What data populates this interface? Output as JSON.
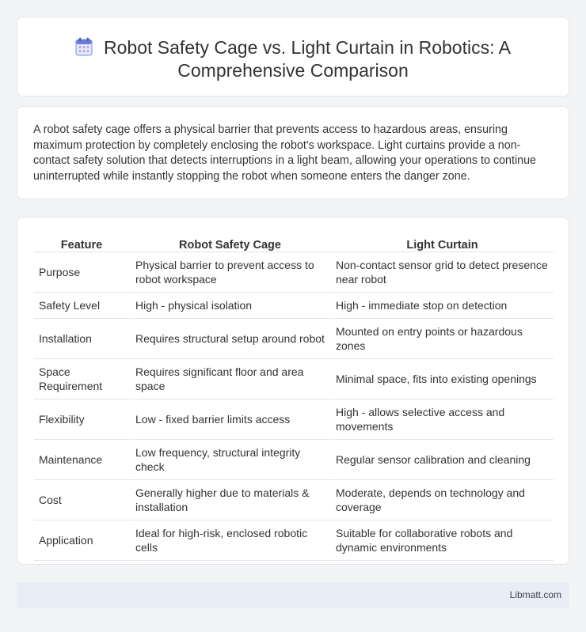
{
  "header": {
    "title": "Robot Safety Cage vs. Light Curtain in Robotics: A Comprehensive Comparison",
    "icon": "calendar-icon"
  },
  "intro": {
    "text": "A robot safety cage offers a physical barrier that prevents access to hazardous areas, ensuring maximum protection by completely enclosing the robot's workspace. Light curtains provide a non-contact safety solution that detects interruptions in a light beam, allowing your operations to continue uninterrupted while instantly stopping the robot when someone enters the danger zone."
  },
  "table": {
    "headers": [
      "Feature",
      "Robot Safety Cage",
      "Light Curtain"
    ],
    "rows": [
      [
        "Purpose",
        "Physical barrier to prevent access to robot workspace",
        "Non-contact sensor grid to detect presence near robot"
      ],
      [
        "Safety Level",
        "High - physical isolation",
        "High - immediate stop on detection"
      ],
      [
        "Installation",
        "Requires structural setup around robot",
        "Mounted on entry points or hazardous zones"
      ],
      [
        "Space Requirement",
        "Requires significant floor and area space",
        "Minimal space, fits into existing openings"
      ],
      [
        "Flexibility",
        "Low - fixed barrier limits access",
        "High - allows selective access and movements"
      ],
      [
        "Maintenance",
        "Low frequency, structural integrity check",
        "Regular sensor calibration and cleaning"
      ],
      [
        "Cost",
        "Generally higher due to materials & installation",
        "Moderate, depends on technology and coverage"
      ],
      [
        "Application",
        "Ideal for high-risk, enclosed robotic cells",
        "Suitable for collaborative robots and dynamic environments"
      ]
    ]
  },
  "footer": {
    "brand": "Libmatt.com"
  },
  "colors": {
    "background": "#f3f4f6",
    "card": "#ffffff",
    "footer": "#e8edf7",
    "icon_accent": "#6b7fd7"
  }
}
